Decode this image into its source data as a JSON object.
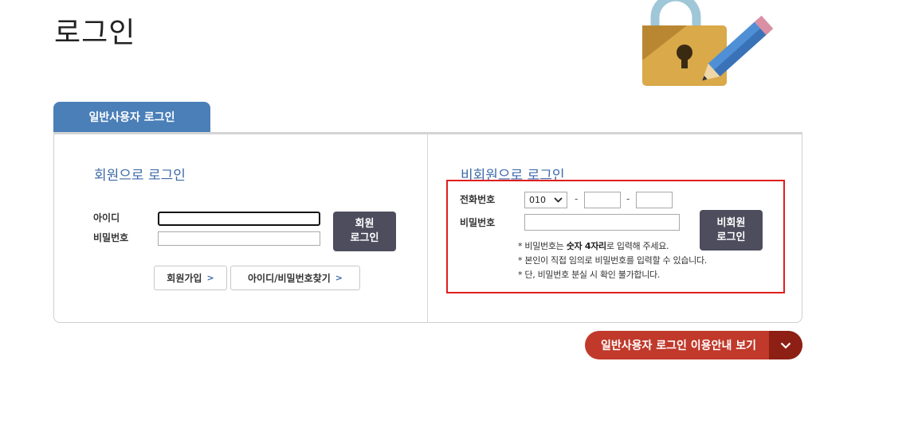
{
  "page": {
    "title": "로그인"
  },
  "tab": {
    "label": "일반사용자 로그인"
  },
  "member": {
    "title": "회원으로 로그인",
    "id_label": "아이디",
    "id_value": "",
    "password_label": "비밀번호",
    "password_value": "",
    "login_button": [
      "회원",
      "로그인"
    ],
    "join_button": "회원가입",
    "find_button": "아이디/비밀번호찾기"
  },
  "guest": {
    "title": "비회원으로 로그인",
    "phone_label": "전화번호",
    "phone_prefix_selected": "010",
    "phone_separator": "-",
    "phone_middle_value": "",
    "phone_last_value": "",
    "password_label": "비밀번호",
    "password_value": "",
    "login_button": [
      "비회원",
      "로그인"
    ],
    "notice_1_prefix": "* 비밀번호는 ",
    "notice_1_bold": "숫자 4자리",
    "notice_1_suffix": "로 입력해 주세요.",
    "notice_2": "* 본인이 직접 임의로 비밀번호를 입력할 수 있습니다.",
    "notice_3": "* 단, 비밀번호 분실 시 확인 불가합니다."
  },
  "guide_button": {
    "label": "일반사용자 로그인 이용안내 보기"
  },
  "icons": {
    "illustration": "lock-with-pencil-icon",
    "link_arrow": "chevron-right-icon",
    "guide_arrow": "chevron-down-icon",
    "select_arrow": "chevron-down-icon"
  },
  "colors": {
    "tab": "#4a7fb8",
    "section_title": "#3d6aa8",
    "dark_button": "#4d4d5e",
    "guide_button": "#c0392b",
    "guide_arrow": "#8e1f14",
    "highlight_frame": "#e01e1e"
  }
}
